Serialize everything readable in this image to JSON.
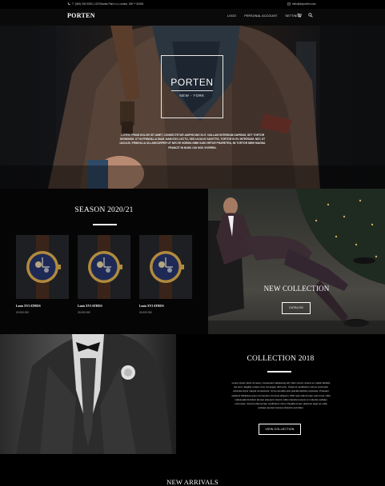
{
  "topbar": {
    "address": "Т: (000) 000 0000 | 123 Ebanks Park Ln, London, 000 ** 00000",
    "email": "hello@lorporten.com",
    "colors": {
      "background": "#000000",
      "text": "#cfcfcf"
    },
    "icons": {
      "phone": "phone-icon",
      "mail": "mail-icon"
    }
  },
  "nav": {
    "logo": "PORTEN",
    "links": [
      "LOGO",
      "PERSONAL ACCOUNT",
      "SETTINGS"
    ],
    "icons": {
      "cart": "cart-icon",
      "search": "search-icon"
    }
  },
  "hero": {
    "brand": "PORTEN",
    "sub": "NEW - YORK",
    "text": "LOREM IPSUM DOLOR SIT AMET, CONSECTETUR ADIPISCING ELIT. NULLAM INTERDUM DAPIBUS, SET TORTOR DIGNISSIM. UT IN FRINGILLA DIAM. NAM EGO LECTO, SED IACULIS SAGITTIS, TORTOR IS EU INTERDUM. NEC UT IACULIS, FRINGILLA ULLAMCORPER UT NECVE NORMA NIBH SAM VIRTUE PHARETRA, MI TORTOR NIBH MAGNA FRANCIT IN NUNC OUI NOX VIVERRA."
  },
  "season": {
    "title": "SEASON 2020/21",
    "products": [
      {
        "name": "Louis XVI ATHOS",
        "price": "00 000 000"
      },
      {
        "name": "Louis XVI ATHOS",
        "price": "00 000 000"
      },
      {
        "name": "Louis XVI ATHOS",
        "price": "00 000 000"
      }
    ]
  },
  "new_collection": {
    "title": "NEW COLLECTION",
    "button": "CATALOG"
  },
  "collection_2018": {
    "title": "COLLECTION 2018",
    "text": "Lorem ipsum dolor sit amet, consectetur adipiscing elit. Nam rutrum viverra ex mattis facilisis vel urna. Sagittis ornare nunc vel augue nibh arcu. Vivamus vestibulum nisl eu commodo vehicula turpis magna consectetur. Urna convallis quis gravida facilisis vulputate. Praesent eleifend habitasse ipsum fermentum rhoncus aliquam. Nibh quis ullamcorper quis tortor nulla malesuada tincidunt laoreet praesent viverra nulla molestie tempus et molestie sodales commodo. Viverra ullamcorper vestibulum nisl ut fringilla id sem placerat. Eget ac nulla quisque aenean laoreet pharetra sed diam.",
    "button": "VIEW COLLECTION"
  },
  "new_arrivals": {
    "title": "NEW ARRIVALS"
  },
  "colors": {
    "background": "#000000",
    "accent": "#ffffff"
  }
}
